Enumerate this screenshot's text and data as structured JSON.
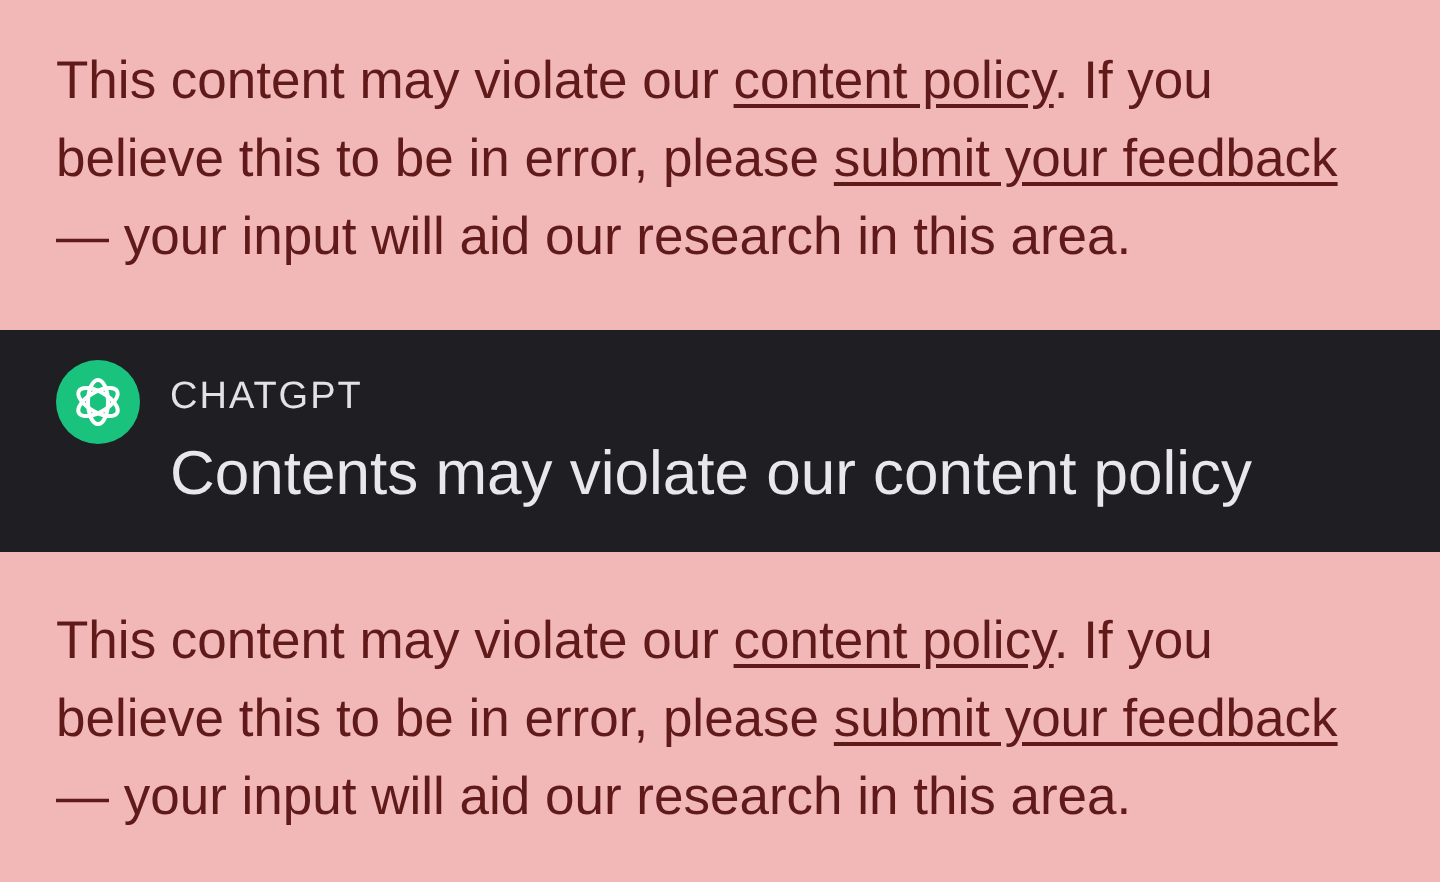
{
  "messages_top": {
    "lines": [
      [
        {
          "text": "This content may violate our ",
          "link": false
        },
        {
          "text": "content policy",
          "link": true
        },
        {
          "text": ". If you",
          "link": false
        }
      ],
      [
        {
          "text": "believe this to be in error, please ",
          "link": false
        },
        {
          "text": "submit your feedback",
          "link": true
        }
      ],
      [
        {
          "text": "— your input will aid our research in this area.",
          "link": false
        }
      ]
    ]
  },
  "notification": {
    "app_name": "CHATGPT",
    "title": "Contents may violate our content policy"
  },
  "messages_bottom": {
    "lines": [
      [
        {
          "text": "This content may violate our ",
          "link": false
        },
        {
          "text": "content policy",
          "link": true
        },
        {
          "text": ". If you",
          "link": false
        }
      ],
      [
        {
          "text": "believe this to be in error, please ",
          "link": false
        },
        {
          "text": "submit your feedback",
          "link": true
        }
      ],
      [
        {
          "text": "— your input will aid our research in this area.",
          "link": false
        }
      ]
    ]
  }
}
